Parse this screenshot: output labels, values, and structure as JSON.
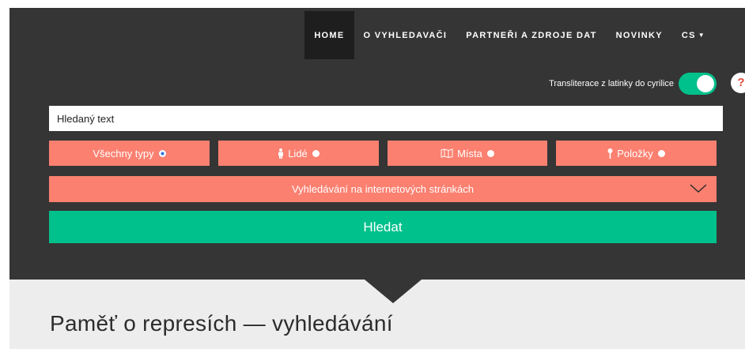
{
  "nav": {
    "items": [
      {
        "label": "HOME"
      },
      {
        "label": "O VYHLEDAVAČI"
      },
      {
        "label": "PARTNEŘI A ZDROJE DAT"
      },
      {
        "label": "NOVINKY"
      }
    ],
    "lang": "CS"
  },
  "translit": {
    "label": "Transliterace z latinky do cyrilice",
    "enabled": true
  },
  "help": {
    "symbol": "?"
  },
  "search": {
    "placeholder": "Hledaný text",
    "value": ""
  },
  "types": [
    {
      "label": "Všechny typy",
      "icon": "none",
      "selected": true
    },
    {
      "label": "Lidé",
      "icon": "person-icon",
      "selected": false
    },
    {
      "label": "Místa",
      "icon": "map-icon",
      "selected": false
    },
    {
      "label": "Položky",
      "icon": "pin-icon",
      "selected": false
    }
  ],
  "web_search": {
    "label": "Vyhledávání na internetových stránkách"
  },
  "submit": {
    "label": "Hledat"
  },
  "page": {
    "title": "Paměť o represích — vyhledávání"
  },
  "colors": {
    "dark": "#353535",
    "salmon": "#fb8070",
    "green": "#00c08b",
    "light": "#ededed"
  }
}
